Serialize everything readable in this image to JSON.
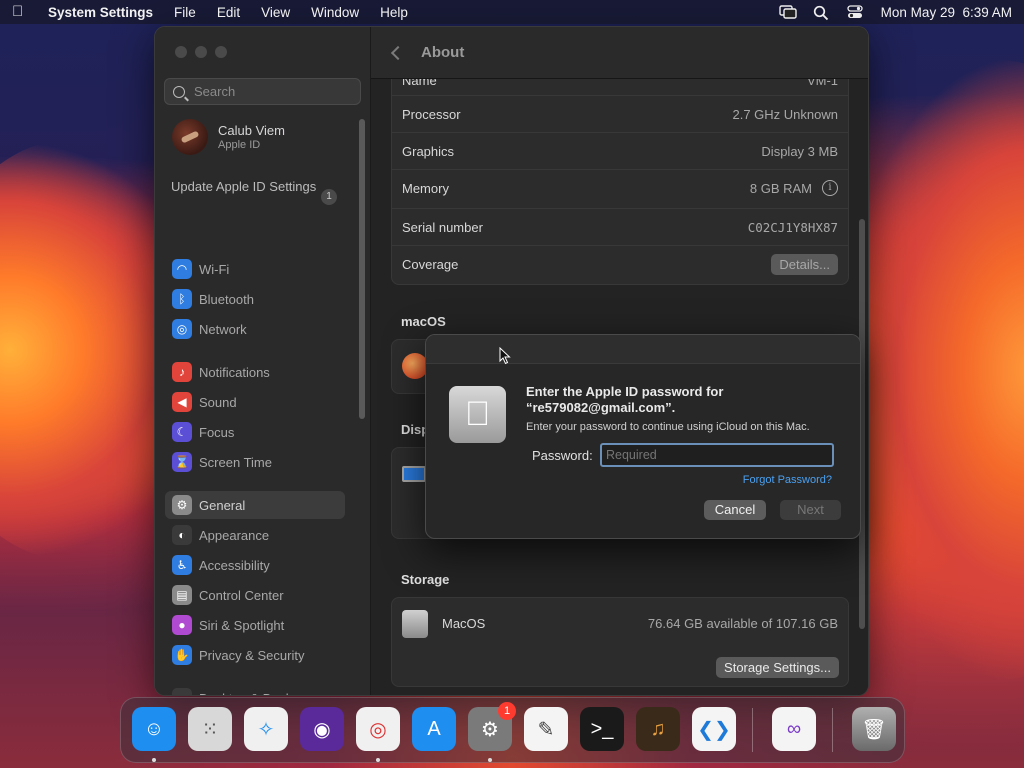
{
  "menubar": {
    "app_name": "System Settings",
    "menus": [
      "File",
      "Edit",
      "View",
      "Window",
      "Help"
    ],
    "clock": "Mon May 29  6:39 AM"
  },
  "sidebar": {
    "search_placeholder": "Search",
    "profile": {
      "name": "Calub Viem",
      "subtitle": "Apple ID"
    },
    "update": {
      "label": "Update Apple ID Settings",
      "badge": "1"
    },
    "items": [
      {
        "label": "Wi-Fi",
        "icon": "wifi-icon",
        "color": "#2f7de1"
      },
      {
        "label": "Bluetooth",
        "icon": "bluetooth-icon",
        "color": "#2f7de1"
      },
      {
        "label": "Network",
        "icon": "globe-icon",
        "color": "#2f7de1"
      },
      {
        "label": "Notifications",
        "icon": "bell-icon",
        "color": "#e0443a"
      },
      {
        "label": "Sound",
        "icon": "speaker-icon",
        "color": "#e0443a"
      },
      {
        "label": "Focus",
        "icon": "moon-icon",
        "color": "#5b4fd6"
      },
      {
        "label": "Screen Time",
        "icon": "hourglass-icon",
        "color": "#5b4fd6"
      },
      {
        "label": "General",
        "icon": "gear-icon",
        "color": "#8a8a8a"
      },
      {
        "label": "Appearance",
        "icon": "appearance-icon",
        "color": "#3a3a3a"
      },
      {
        "label": "Accessibility",
        "icon": "accessibility-icon",
        "color": "#2f7de1"
      },
      {
        "label": "Control Center",
        "icon": "control-center-icon",
        "color": "#8a8a8a"
      },
      {
        "label": "Siri & Spotlight",
        "icon": "siri-icon",
        "color": "#b04ad0"
      },
      {
        "label": "Privacy & Security",
        "icon": "hand-icon",
        "color": "#2f7de1"
      },
      {
        "label": "Desktop & Dock",
        "icon": "dock-icon",
        "color": "#3a3a3a"
      }
    ]
  },
  "content": {
    "title": "About",
    "partial_row": {
      "label": "Name",
      "value": "VM-1"
    },
    "specs": [
      {
        "label": "Processor",
        "value": "2.7 GHz Unknown"
      },
      {
        "label": "Graphics",
        "value": "Display 3 MB"
      },
      {
        "label": "Memory",
        "value": "8 GB RAM"
      },
      {
        "label": "Serial number",
        "value": "C02CJ1Y8HX87"
      },
      {
        "label": "Coverage",
        "button": "Details..."
      }
    ],
    "macos_heading": "macOS",
    "displays_heading": "Displays",
    "storage_heading": "Storage",
    "storage": {
      "name": "MacOS",
      "value": "76.64 GB available of 107.16 GB",
      "button": "Storage Settings..."
    }
  },
  "dialog": {
    "heading_line1": "Enter the Apple ID password for",
    "heading_line2": "“re579082@gmail.com”.",
    "subtitle": "Enter your password to continue using iCloud on this Mac.",
    "password_label": "Password:",
    "password_placeholder": "Required",
    "forgot": "Forgot Password?",
    "cancel": "Cancel",
    "next": "Next"
  },
  "dock": {
    "apps": [
      {
        "name": "Finder",
        "icon": "finder-icon",
        "color": "#1e8ef0"
      },
      {
        "name": "Launchpad",
        "icon": "launchpad-icon",
        "color": "#d8d8d8"
      },
      {
        "name": "Safari",
        "icon": "safari-icon",
        "color": "#f0f0f0"
      },
      {
        "name": "Firefox",
        "icon": "firefox-icon",
        "color": "#5a2a9a"
      },
      {
        "name": "Chrome",
        "icon": "chrome-icon",
        "color": "#f0f0f0"
      },
      {
        "name": "App Store",
        "icon": "app-store-icon",
        "color": "#1e8ef0"
      },
      {
        "name": "System Settings",
        "icon": "system-settings-icon",
        "color": "#7a7a7a",
        "badge": "1"
      },
      {
        "name": "TextEdit",
        "icon": "textedit-icon",
        "color": "#f4f4f4"
      },
      {
        "name": "Terminal",
        "icon": "terminal-icon",
        "color": "#1a1a1a"
      },
      {
        "name": "GarageBand",
        "icon": "garageband-icon",
        "color": "#3a2a1a"
      },
      {
        "name": "Visual Studio Code",
        "icon": "vscode-icon",
        "color": "#f4f4f4"
      },
      {
        "name": "Visual Studio",
        "icon": "visual-studio-icon",
        "color": "#f4f4f4"
      },
      {
        "name": "Trash",
        "icon": "trash-icon",
        "color": "#8a8a8a"
      }
    ]
  }
}
